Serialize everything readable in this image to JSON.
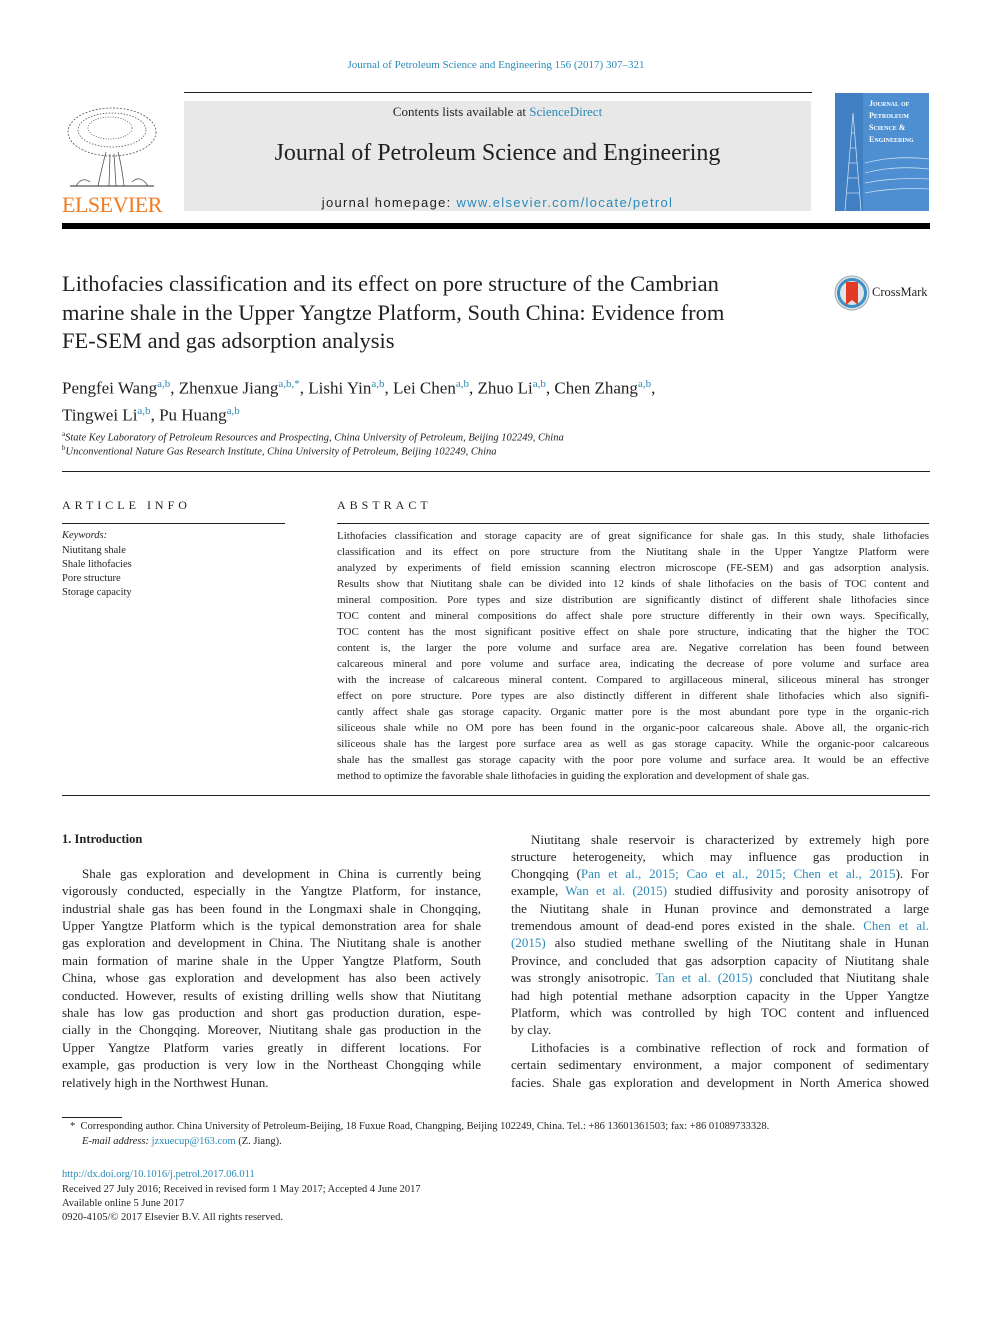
{
  "running_head": "Journal of Petroleum Science and Engineering 156 (2017) 307–321",
  "header": {
    "contents_prefix": "Contents lists available at ",
    "contents_link": "ScienceDirect",
    "journal_title": "Journal of Petroleum Science and Engineering",
    "homepage_prefix": "journal homepage: ",
    "homepage_link": "www.elsevier.com/locate/petrol",
    "publisher_logo_text": "ELSEVIER",
    "cover_title_lines": [
      "Journal of",
      "Petroleum",
      "Science &",
      "Engineering"
    ],
    "publisher_color": "#f07b22",
    "link_color": "#2a8ab8"
  },
  "article": {
    "title_lines": [
      "Lithofacies classification and its effect on pore structure of the Cambrian",
      "marine shale in the Upper Yangtze Platform, South China: Evidence from",
      "FE-SEM and gas adsorption analysis"
    ],
    "crossmark_label": "CrossMark",
    "authors": [
      {
        "name": "Pengfei Wang",
        "sup": "a,b",
        "sep": ", "
      },
      {
        "name": "Zhenxue Jiang",
        "sup": "a,b,*",
        "sep": ", "
      },
      {
        "name": "Lishi Yin",
        "sup": "a,b",
        "sep": ", "
      },
      {
        "name": "Lei Chen",
        "sup": "a,b",
        "sep": ", "
      },
      {
        "name": "Zhuo Li",
        "sup": "a,b",
        "sep": ", "
      },
      {
        "name": "Chen Zhang",
        "sup": "a,b",
        "sep": ","
      },
      {
        "name": "Tingwei Li",
        "sup": "a,b",
        "sep": ", "
      },
      {
        "name": "Pu Huang",
        "sup": "a,b",
        "sep": ""
      }
    ],
    "affiliations": [
      {
        "mark": "a",
        "text": "State Key Laboratory of Petroleum Resources and Prospecting, China University of Petroleum, Beijing 102249, China"
      },
      {
        "mark": "b",
        "text": "Unconventional Nature Gas Research Institute, China University of Petroleum, Beijing 102249, China"
      }
    ]
  },
  "article_info": {
    "heading": "ARTICLE INFO",
    "keywords_label": "Keywords:",
    "keywords": [
      "Niutitang shale",
      "Shale lithofacies",
      "Pore structure",
      "Storage capacity"
    ]
  },
  "abstract": {
    "heading": "ABSTRACT",
    "lines": [
      "Lithofacies classification and storage capacity are of great significance for shale gas. In this study, shale lithofacies",
      "classification and its effect on pore structure from the Niutitang shale in the Upper Yangtze Platform were",
      "analyzed by experiments of field emission scanning electron microscope (FE-SEM) and gas adsorption analysis.",
      "Results show that Niutitang shale can be divided into 12 kinds of shale lithofacies on the basis of TOC content and",
      "mineral composition. Pore types and size distribution are significantly distinct of different shale lithofacies since",
      "TOC content and mineral compositions do affect shale pore structure differently in their own ways. Specifically,",
      "TOC content has the most significant positive effect on shale pore structure, indicating that the higher the TOC",
      "content is, the larger the pore volume and surface area are. Negative correlation has been found between",
      "calcareous mineral and pore volume and surface area, indicating the decrease of pore volume and surface area",
      "with the increase of calcareous mineral content. Compared to argillaceous mineral, siliceous mineral has stronger",
      "effect on pore structure. Pore types are also distinctly different in different shale lithofacies which also signifi-",
      "cantly affect shale gas storage capacity. Organic matter pore is the most abundant pore type in the organic-rich",
      "siliceous shale while no OM pore has been found in the organic-poor calcareous shale. Above all, the organic-rich",
      "siliceous shale has the largest pore surface area as well as gas storage capacity. While the organic-poor calcareous",
      "shale has the smallest gas storage capacity with the poor pore volume and surface area. It would be an effective",
      "method to optimize the favorable shale lithofacies in guiding the exploration and development of shale gas."
    ]
  },
  "introduction": {
    "heading": "1.  Introduction",
    "left_lines": [
      "Shale gas exploration and development in China is currently being",
      "vigorously conducted, especially in the Yangtze Platform, for instance,",
      "industrial shale gas has been found in the Longmaxi shale in Chongqing,",
      "Upper Yangtze Platform which is the typical demonstration area for shale",
      "gas exploration and development in China. The Niutitang shale is another",
      "main formation of marine shale in the Upper Yangtze Platform, South",
      "China, whose gas exploration and development has also been actively",
      "conducted. However, results of existing drilling wells show that Niutitang",
      "shale has low gas production and short gas production duration, espe-",
      "cially in the Chongqing. Moreover, Niutitang shale gas production in the",
      "Upper Yangtze Platform varies greatly in different locations. For",
      "example, gas production is very low in the Northeast Chongqing while",
      "relatively high in the Northwest Hunan."
    ],
    "right": {
      "l1": "Niutitang shale reservoir is characterized by extremely high pore",
      "l2": "structure heterogeneity, which may influence gas production in",
      "l3_pre": "Chongqing (",
      "l3_cite1": "Pan et al., 2015; Cao et al., 2015; Chen et al., 2015",
      "l3_post": "). For",
      "l4_pre": "example, ",
      "l4_cite": "Wan et al. (2015)",
      "l4_post": " studied diffusivity and porosity anisotropy of",
      "l5": "the Niutitang shale in Hunan province and demonstrated a large",
      "l6_pre": "tremendous amount of dead-end pores existed in the shale. ",
      "l6_cite": "Chen et al.",
      "l7_cite": "(2015)",
      "l7_post": " also studied methane swelling of the Niutitang shale in Hunan",
      "l8": "Province, and concluded that gas adsorption capacity of Niutitang shale",
      "l9_pre": "was strongly anisotropic. ",
      "l9_cite": "Tan et al. (2015)",
      "l9_post": " concluded that Niutitang shale",
      "l10": "had high potential methane adsorption capacity in the Upper Yangtze",
      "l11": "Platform, which was controlled by high TOC content and influenced",
      "l12": "by clay.",
      "l13": "Lithofacies is a combinative reflection of rock and formation of",
      "l14": "certain sedimentary environment, a major component of sedimentary",
      "l15": "facies. Shale gas exploration and development in North America showed"
    }
  },
  "footnotes": {
    "corresponding": "Corresponding author. China University of Petroleum-Beijing, 18 Fuxue Road, Changping, Beijing 102249, China. Tel.: +86 13601361503; fax: +86 01089733328.",
    "corresponding_mark": "*",
    "email_label": "E-mail address: ",
    "email": "jzxuecup@163.com",
    "email_suffix": " (Z. Jiang).",
    "doi": "http://dx.doi.org/10.1016/j.petrol.2017.06.011",
    "received": "Received 27 July 2016; Received in revised form 1 May 2017; Accepted 4 June 2017",
    "available": "Available online 5 June 2017",
    "copyright": "0920-4105/© 2017 Elsevier B.V. All rights reserved."
  }
}
